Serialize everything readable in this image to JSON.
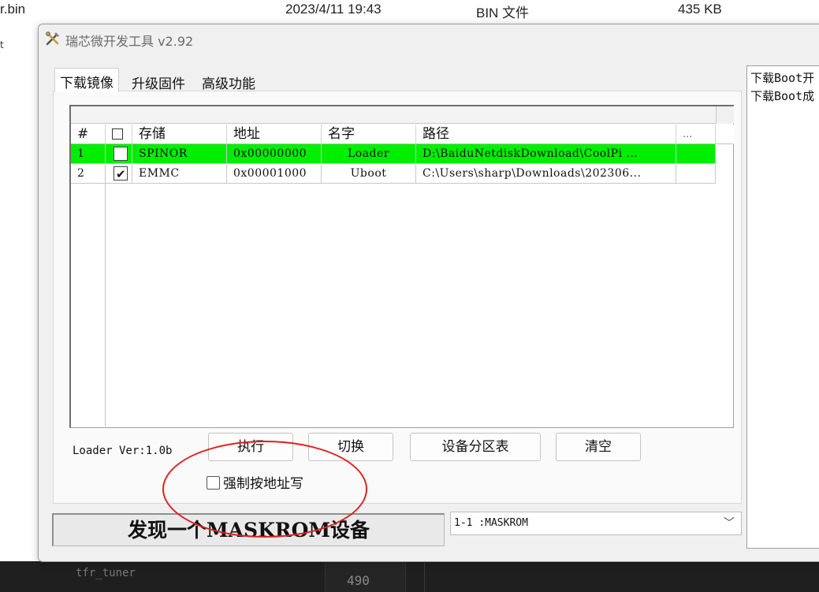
{
  "background": {
    "file_name": "r.bin",
    "file_date": "2023/4/11 19:43",
    "file_type": "BIN 文件",
    "file_size": "435 KB",
    "side_text": "t",
    "editor_tab": "tfr_tuner",
    "editor_line": "490"
  },
  "window": {
    "title": "瑞芯微开发工具 v2.92",
    "icon": "tools-icon"
  },
  "tabs": [
    {
      "label": "下载镜像",
      "active": true
    },
    {
      "label": "升级固件",
      "active": false
    },
    {
      "label": "高级功能",
      "active": false
    }
  ],
  "table": {
    "headers": [
      "#",
      "",
      "存储",
      "地址",
      "名字",
      "路径",
      "..."
    ],
    "rows": [
      {
        "num": "1",
        "checked": false,
        "storage": "SPINOR",
        "address": "0x00000000",
        "name": "Loader",
        "path": "D:\\BaiduNetdiskDownload\\CoolPi ...",
        "selected": true
      },
      {
        "num": "2",
        "checked": true,
        "storage": "EMMC",
        "address": "0x00001000",
        "name": "Uboot",
        "path": "C:\\Users\\sharp\\Downloads\\202306...",
        "selected": false
      }
    ]
  },
  "controls": {
    "loader_ver": "Loader Ver:1.0b",
    "run_button": "执行",
    "switch_button": "切换",
    "partition_button": "设备分区表",
    "clear_button": "清空",
    "force_address_label": "强制按地址写",
    "force_address_checked": false
  },
  "status": {
    "message": "发现一个MASKROM设备",
    "device_selected": "1-1  :MASKROM"
  },
  "log": {
    "lines": [
      "下载Boot开",
      "下载Boot成"
    ]
  },
  "colors": {
    "selected_row": "#00ee00",
    "annotation_ellipse": "#e02020"
  }
}
